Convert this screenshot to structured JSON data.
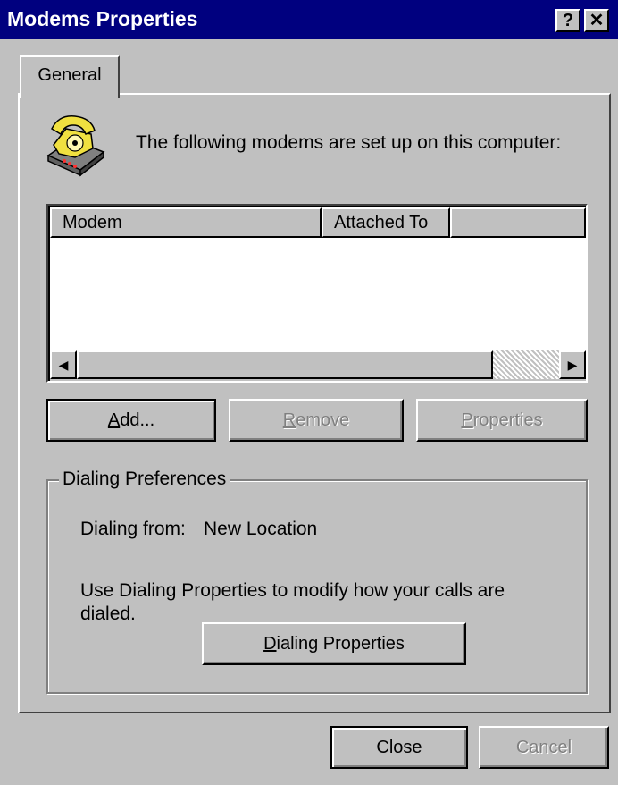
{
  "window": {
    "title": "Modems Properties",
    "help_button": "?",
    "close_button": "✕"
  },
  "tabs": [
    {
      "label": "General",
      "selected": true
    }
  ],
  "intro_text": "The following modems are set up on this computer:",
  "modem_list": {
    "columns": [
      "Modem",
      "Attached To",
      ""
    ],
    "rows": []
  },
  "buttons": {
    "add": {
      "prefix": "",
      "mnemonic": "A",
      "suffix": "dd...",
      "enabled": true
    },
    "remove": {
      "prefix": "",
      "mnemonic": "R",
      "suffix": "emove",
      "enabled": false
    },
    "properties": {
      "prefix": "",
      "mnemonic": "P",
      "suffix": "roperties",
      "enabled": false
    }
  },
  "dialing_preferences": {
    "group_title": "Dialing Preferences",
    "dialing_from_label": "Dialing from:",
    "dialing_from_value": "New Location",
    "info_text": "Use Dialing Properties to modify how your calls are dialed.",
    "dialing_properties_button": {
      "prefix": "",
      "mnemonic": "D",
      "suffix": "ialing Properties"
    }
  },
  "footer": {
    "close_label": "Close",
    "cancel_label": "Cancel",
    "cancel_enabled": false
  },
  "icons": {
    "modem_icon": "yellow-telephone-modem-icon",
    "scroll_left": "◀",
    "scroll_right": "▶"
  },
  "colors": {
    "titlebar": "#00007f",
    "face": "#c0c0c0",
    "phone": "#f0e040"
  }
}
